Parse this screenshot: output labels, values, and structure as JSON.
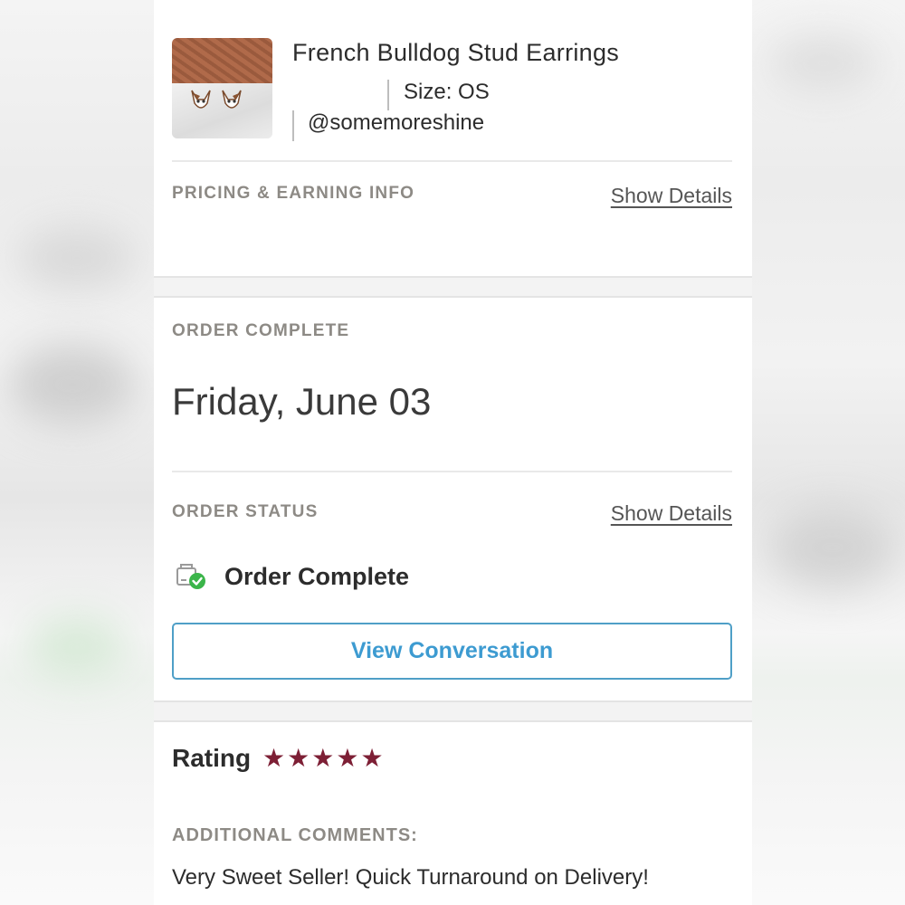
{
  "product": {
    "title": "French Bulldog Stud Earrings",
    "size": "Size: OS",
    "seller": "@somemoreshine"
  },
  "pricing": {
    "label": "PRICING & EARNING INFO",
    "details_link": "Show Details"
  },
  "order_complete": {
    "label": "ORDER COMPLETE",
    "date": "Friday, June 03"
  },
  "order_status": {
    "label": "ORDER STATUS",
    "details_link": "Show Details",
    "status": "Order Complete",
    "view_button": "View Conversation"
  },
  "rating": {
    "label": "Rating",
    "stars": 5,
    "star_glyph": "★",
    "star_color": "#7d1f35"
  },
  "comments": {
    "label": "ADDITIONAL COMMENTS:",
    "text": "Very Sweet Seller! Quick Turnaround on Delivery!"
  },
  "colors": {
    "accent_blue": "#3d9bd1",
    "label_gray": "#8d8a85",
    "status_green": "#3bb54a"
  }
}
